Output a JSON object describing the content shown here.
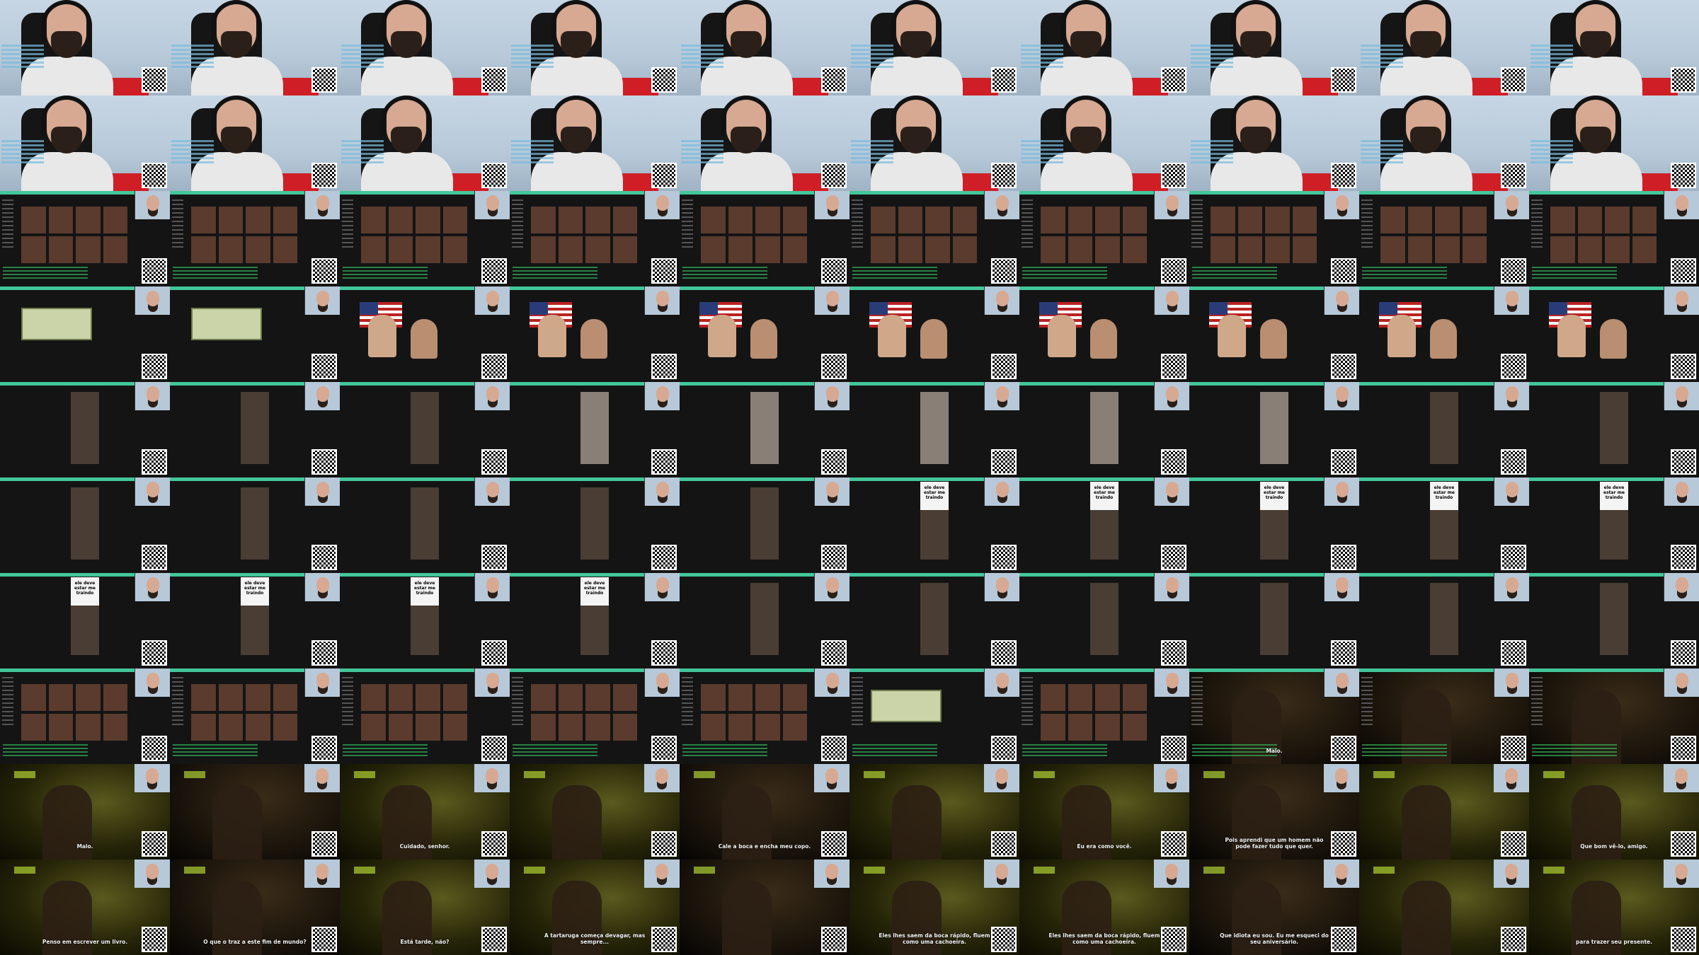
{
  "grid": {
    "columns": 10,
    "rows": 10
  },
  "rows": [
    {
      "scene": "webcam",
      "cells": 10
    },
    {
      "scene": "webcam",
      "cells": 10
    },
    {
      "scene": "browser",
      "cells": 10
    },
    {
      "scene": "flag",
      "cells": 10
    },
    {
      "scene": "vert",
      "cells": 10
    },
    {
      "scene": "meme",
      "cells": 10,
      "meme_text": "ele deve estar me traindo"
    },
    {
      "scene": "meme",
      "cells": 10,
      "meme_text": "ele deve estar me traindo"
    },
    {
      "scene": "browser",
      "cells": 10
    },
    {
      "scene": "film",
      "cells": 10
    },
    {
      "scene": "film",
      "cells": 10
    }
  ],
  "subtitles": {
    "r8": [
      "Malo.",
      "",
      "Cuidado, senhor.",
      "",
      "Cale a boca e encha meu copo.",
      "",
      "Eu era como você.",
      "Pois aprendi que um homem não pode fazer tudo que quer.",
      "",
      "Que bom vê-lo, amigo."
    ],
    "r9": [
      "Penso em escrever um livro.",
      "O que o traz a este fim de mundo?",
      "Está tarde, não?",
      "A tartaruga começa devagar, mas sempre...",
      "",
      "Eles lhes saem da boca rápido, fluem como uma cachoeira.",
      "Eles lhes saem da boca rápido, fluem como uma cachoeira.",
      "Que idiota eu sou. Eu me esqueci do seu aniversário.",
      "",
      "para trazer seu presente."
    ]
  },
  "row7_subtitle": {
    "col7": "Malo."
  },
  "colors": {
    "accent": "#43c79a",
    "chair_red": "#d01e26",
    "film_green": "#c9f03a"
  },
  "icons": [
    "qr-code-icon"
  ]
}
